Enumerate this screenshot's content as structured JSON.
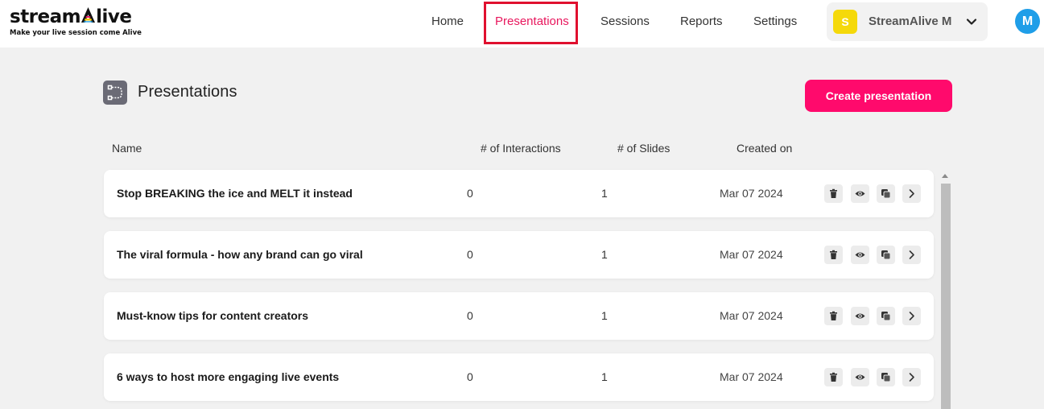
{
  "app": {
    "logo_text_before": "stream",
    "logo_text_after": "live",
    "tagline": "Make your live session come Alive"
  },
  "nav": {
    "home": "Home",
    "presentations": "Presentations",
    "sessions": "Sessions",
    "reports": "Reports",
    "settings": "Settings"
  },
  "account": {
    "initial": "S",
    "name": "StreamAlive M",
    "avatar_initial": "M"
  },
  "page": {
    "title": "Presentations",
    "create_label": "Create presentation"
  },
  "table": {
    "headers": {
      "name": "Name",
      "interactions": "# of Interactions",
      "slides": "# of Slides",
      "created": "Created on"
    },
    "rows": [
      {
        "name": "Stop BREAKING the ice and MELT it instead",
        "interactions": "0",
        "slides": "1",
        "created": "Mar 07 2024"
      },
      {
        "name": "The viral formula - how any brand can go viral",
        "interactions": "0",
        "slides": "1",
        "created": "Mar 07 2024"
      },
      {
        "name": "Must-know tips for content creators",
        "interactions": "0",
        "slides": "1",
        "created": "Mar 07 2024"
      },
      {
        "name": "6 ways to host more engaging live events",
        "interactions": "0",
        "slides": "1",
        "created": "Mar 07 2024"
      }
    ],
    "row_actions": [
      "trash-icon",
      "eye-icon",
      "copy-icon",
      "chevron-right-icon"
    ]
  },
  "colors": {
    "accent": "#ff0a6c",
    "nav_active": "#e8175d",
    "highlight_border": "#e0102f",
    "account_badge": "#f5d90a",
    "avatar": "#1f9ee8"
  }
}
